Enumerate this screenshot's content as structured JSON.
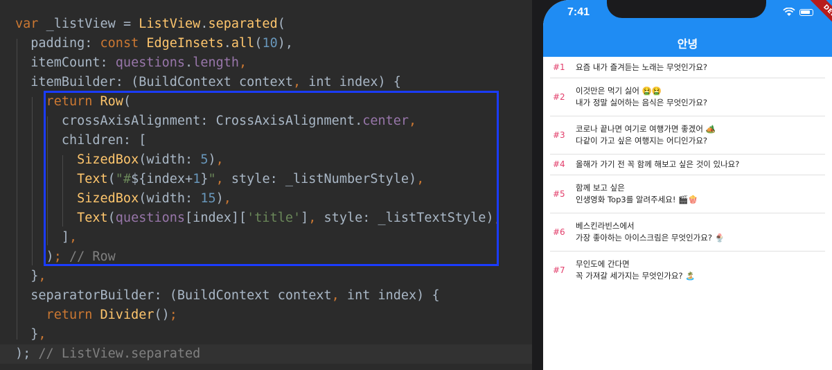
{
  "editor": {
    "lines": [
      [
        [
          "kw",
          "var "
        ],
        [
          "pl",
          "_listView = "
        ],
        [
          "fn",
          "ListView"
        ],
        [
          "pl",
          "."
        ],
        [
          "fn",
          "separated"
        ],
        [
          "pl",
          "("
        ]
      ],
      [
        [
          "pl",
          "  padding: "
        ],
        [
          "kw",
          "const "
        ],
        [
          "fn",
          "EdgeInsets"
        ],
        [
          "pl",
          "."
        ],
        [
          "fn",
          "all"
        ],
        [
          "pl",
          "("
        ],
        [
          "num",
          "10"
        ],
        [
          "pl",
          "),"
        ]
      ],
      [
        [
          "pl",
          "  itemCount: "
        ],
        [
          "prop",
          "questions"
        ],
        [
          "pl",
          "."
        ],
        [
          "prop",
          "length"
        ],
        [
          "kw",
          ","
        ]
      ],
      [
        [
          "pl",
          "  itemBuilder: (BuildContext context"
        ],
        [
          "kw",
          ","
        ],
        [
          "pl",
          " int index) {"
        ]
      ],
      [
        [
          "kw",
          "    return "
        ],
        [
          "fn",
          "Row"
        ],
        [
          "pl",
          "("
        ]
      ],
      [
        [
          "pl",
          "      crossAxisAlignment: CrossAxisAlignment."
        ],
        [
          "prop",
          "center"
        ],
        [
          "kw",
          ","
        ]
      ],
      [
        [
          "pl",
          "      children: ["
        ]
      ],
      [
        [
          "fn",
          "        SizedBox"
        ],
        [
          "pl",
          "(width: "
        ],
        [
          "num",
          "5"
        ],
        [
          "pl",
          ")"
        ],
        [
          "kw",
          ","
        ]
      ],
      [
        [
          "fn",
          "        Text"
        ],
        [
          "pl",
          "("
        ],
        [
          "str",
          "\"#"
        ],
        [
          "pl",
          "${index+"
        ],
        [
          "num",
          "1"
        ],
        [
          "pl",
          "}"
        ],
        [
          "str",
          "\""
        ],
        [
          "kw",
          ","
        ],
        [
          "pl",
          " style: _listNumberStyle)"
        ],
        [
          "kw",
          ","
        ]
      ],
      [
        [
          "fn",
          "        SizedBox"
        ],
        [
          "pl",
          "(width: "
        ],
        [
          "num",
          "15"
        ],
        [
          "pl",
          ")"
        ],
        [
          "kw",
          ","
        ]
      ],
      [
        [
          "fn",
          "        Text"
        ],
        [
          "pl",
          "("
        ],
        [
          "prop",
          "questions"
        ],
        [
          "pl",
          "[index]["
        ],
        [
          "str",
          "'title'"
        ],
        [
          "pl",
          "]"
        ],
        [
          "kw",
          ","
        ],
        [
          "pl",
          " style: _listTextStyle)"
        ],
        [
          "kw",
          ","
        ]
      ],
      [
        [
          "pl",
          "      ]"
        ],
        [
          "kw",
          ","
        ]
      ],
      [
        [
          "pl",
          "    )"
        ],
        [
          "kw",
          ";"
        ],
        [
          "cm",
          " // Row"
        ]
      ],
      [
        [
          "pl",
          "  }"
        ],
        [
          "kw",
          ","
        ]
      ],
      [
        [
          "pl",
          "  separatorBuilder: (BuildContext context"
        ],
        [
          "kw",
          ","
        ],
        [
          "pl",
          " int index) {"
        ]
      ],
      [
        [
          "kw",
          "    return "
        ],
        [
          "fn",
          "Divider"
        ],
        [
          "pl",
          "()"
        ],
        [
          "kw",
          ";"
        ]
      ],
      [
        [
          "pl",
          "  }"
        ],
        [
          "kw",
          ","
        ]
      ],
      [
        [
          "pl",
          "); "
        ],
        [
          "cm",
          "// ListView.separated"
        ]
      ]
    ]
  },
  "phone": {
    "status_time": "7:41",
    "app_title": "안녕",
    "debug_label": "DEBUG",
    "items": [
      {
        "num": "#1",
        "text": "요즘 내가 즐겨듣는 노래는 무엇인가요?"
      },
      {
        "num": "#2",
        "text": "이것만은 먹기 싫어 🤮🤮\n내가 정말 싫어하는 음식은 무엇인가요?"
      },
      {
        "num": "#3",
        "text": "코로나 끝나면 여기로 여행가면 좋겠어 🏕️\n다같이 가고 싶은 여행지는 어디인가요?"
      },
      {
        "num": "#4",
        "text": "올해가 가기 전 꼭 함께 해보고 싶은 것이 있나요?"
      },
      {
        "num": "#5",
        "text": "함께 보고 싶은\n인생영화 Top3를 알려주세요! 🎬🍿"
      },
      {
        "num": "#6",
        "text": "베스킨라빈스에서\n가장 좋아하는 아이스크림은 무엇인가요? 🍨"
      },
      {
        "num": "#7",
        "text": "무인도에 간다면\n꼭 가져갈 세가지는 무엇인가요? 🏝️"
      }
    ]
  }
}
